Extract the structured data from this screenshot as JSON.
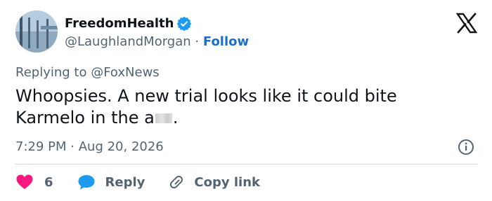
{
  "author": {
    "display_name": "FreedomHealth",
    "handle": "@LaughlandMorgan",
    "separator": "·",
    "follow_label": "Follow",
    "verified_color": "#1d9bf0"
  },
  "reply_context": {
    "prefix": "Replying to",
    "mention": "@FoxNews"
  },
  "tweet": {
    "text_line1": "Whoopsies. A new trial looks like it could bite",
    "text_line2_start": "Karmelo in the a",
    "text_line2_end": "."
  },
  "meta": {
    "time": "7:29 PM",
    "separator": "·",
    "date": "Aug 20, 2026"
  },
  "actions": {
    "like_count": "6",
    "reply_label": "Reply",
    "copy_label": "Copy link"
  },
  "colors": {
    "like": "#f91880",
    "reply": "#1d9bf0",
    "link": "#1d6fc6",
    "muted": "#536471"
  },
  "icons": {
    "logo": "x-logo-icon",
    "verified": "verified-badge-icon",
    "info": "info-icon",
    "like": "heart-icon",
    "reply": "speech-bubble-icon",
    "copy": "link-icon"
  }
}
